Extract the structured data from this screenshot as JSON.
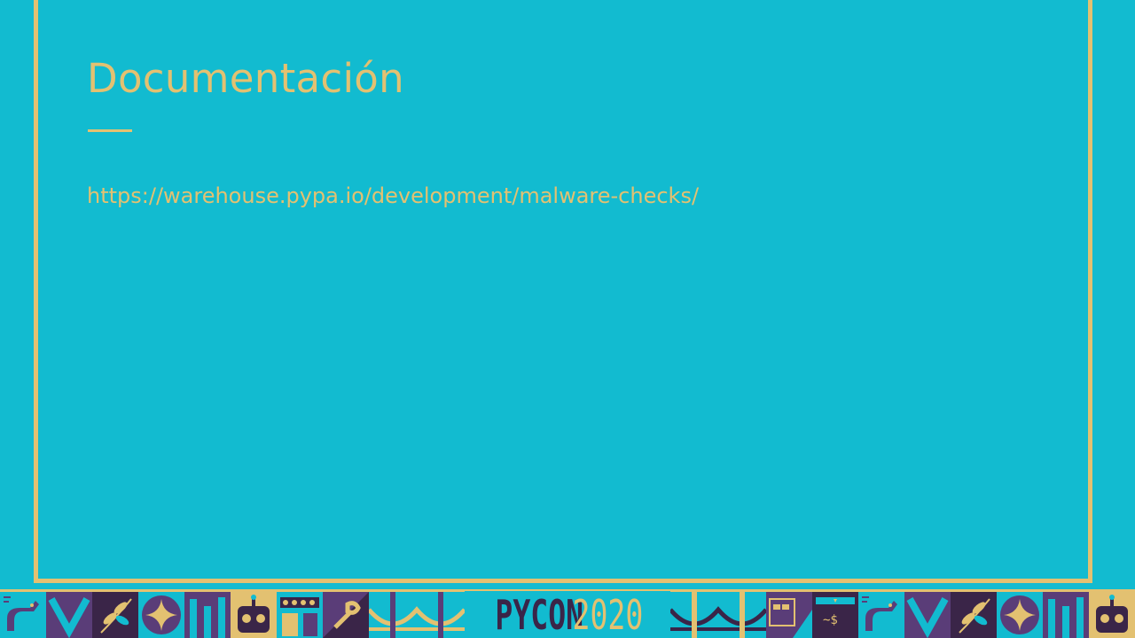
{
  "slide": {
    "title": "Documentación",
    "link": "https://warehouse.pypa.io/development/malware-checks/"
  },
  "footer": {
    "logo_text": "PYCON",
    "logo_year": "2020",
    "terminal_prompt": "~$"
  },
  "colors": {
    "background": "#12bbd0",
    "accent": "#e3c171",
    "purple": "#5a3d78",
    "dark": "#3a2548"
  }
}
